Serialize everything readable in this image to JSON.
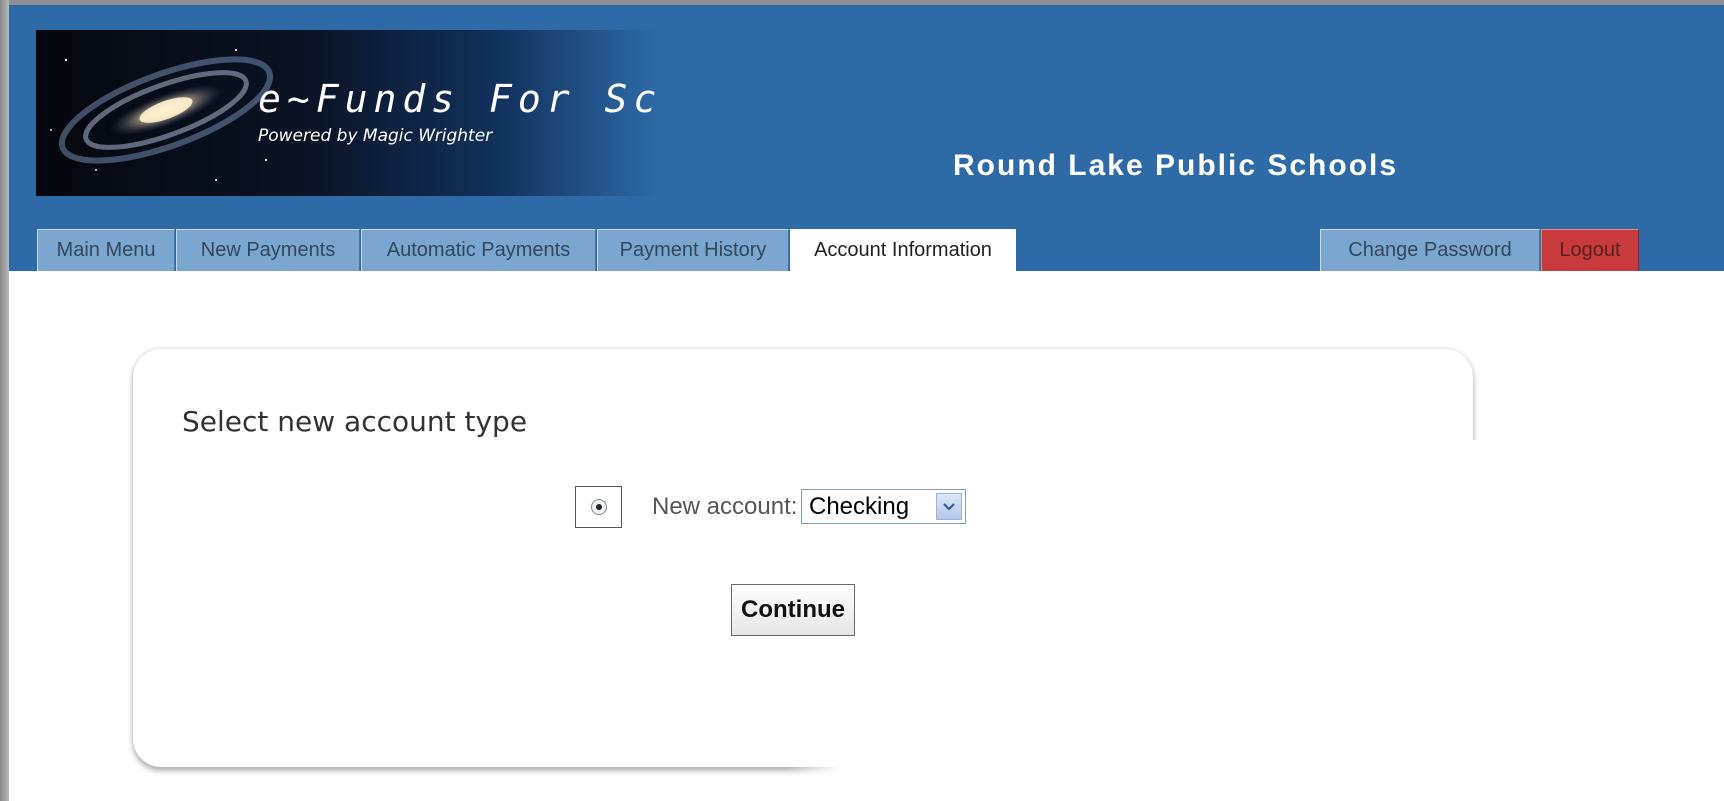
{
  "banner": {
    "title": "e~Funds  For  Schools",
    "subtitle": "Powered by Magic Wrighter",
    "district": "Round Lake Public Schools"
  },
  "nav": {
    "tabs": [
      {
        "label": "Main Menu"
      },
      {
        "label": "New Payments"
      },
      {
        "label": "Automatic Payments"
      },
      {
        "label": "Payment History"
      },
      {
        "label": "Account Information",
        "active": true
      }
    ],
    "right_tabs": [
      {
        "label": "Change Password"
      },
      {
        "label": "Logout"
      }
    ]
  },
  "panel": {
    "title": "Select new account type",
    "radio_selected": true,
    "field_label": "New account:",
    "select_value": "Checking",
    "continue_label": "Continue"
  },
  "colors": {
    "header_blue": "#2d6aa6",
    "tab_blue": "#7aa6d0",
    "logout_red": "#c83a3c"
  },
  "icons": {
    "banner_image": "galaxy-image",
    "select_arrow": "chevron-down-icon"
  }
}
